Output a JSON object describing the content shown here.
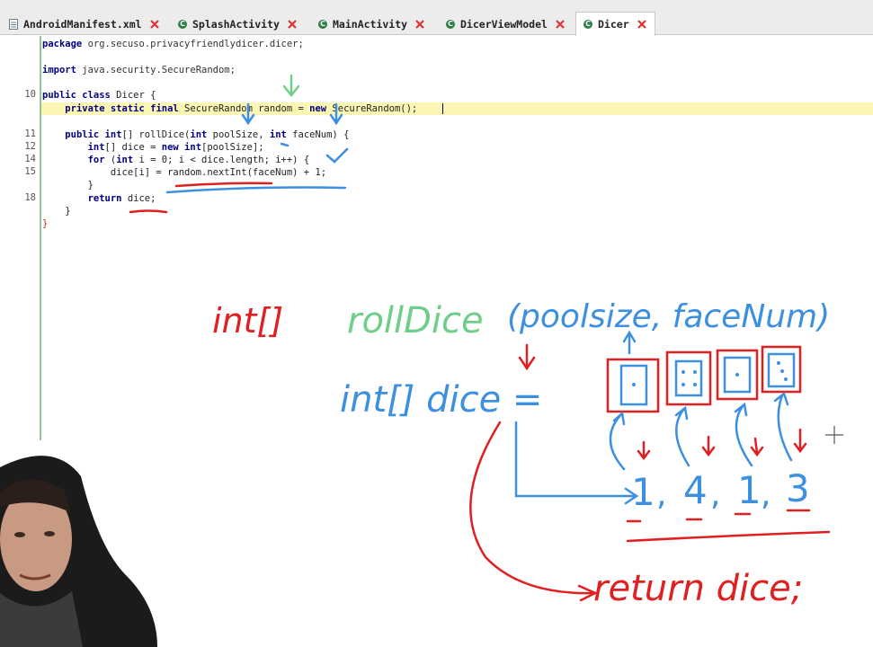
{
  "tabs": [
    {
      "label": "AndroidManifest.xml",
      "icon": "xml-file-icon"
    },
    {
      "label": "SplashActivity",
      "icon": "class-icon"
    },
    {
      "label": "MainActivity",
      "icon": "class-icon"
    },
    {
      "label": "DicerViewModel",
      "icon": "class-icon"
    },
    {
      "label": "Dicer",
      "icon": "class-icon",
      "active": true
    }
  ],
  "editor": {
    "line_numbers": [
      "10",
      "11",
      "12",
      "14",
      "15",
      "18"
    ],
    "code": {
      "package_kw": "package",
      "package_name": " org.secuso.privacyfriendlydicer.dicer;",
      "import_kw": "import",
      "import_name": " java.security.SecureRandom;",
      "class_decl_kw": "public class",
      "class_decl_rest": " Dicer {",
      "field_kw": "private static final",
      "field_type": " SecureRandom random = ",
      "field_new": "new",
      "field_rest": " SecureRandom();",
      "method_kw": "public int",
      "method_rest": "[] rollDice(",
      "method_p1kw": "int",
      "method_p1": " poolSize, ",
      "method_p2kw": "int",
      "method_p2": " faceNum) {",
      "arr_kw": "int",
      "arr_rest": "[] dice = ",
      "arr_new": "new int",
      "arr_rest2": "[poolSize];",
      "for_kw": "for",
      "for_open": " (",
      "for_int": "int",
      "for_rest": " i = 0; i < dice.length; i++) {",
      "assign": "dice[i] = random.nextInt(faceNum) + 1;",
      "close_inner": "}",
      "return_kw": "return",
      "return_rest": " dice;",
      "close_method": "}",
      "close_class": "}"
    }
  },
  "drawing": {
    "signature_return": "int[]",
    "signature_name": "rollDice",
    "signature_params": "(poolsize, faceNum)",
    "dice_decl": "int[] dice =",
    "values": [
      "1",
      "4",
      "1",
      "3"
    ],
    "return_stmt": "return dice;",
    "colors": {
      "red": "#e02020",
      "green": "#6fcf8a",
      "blue": "#3d8fe0"
    }
  }
}
